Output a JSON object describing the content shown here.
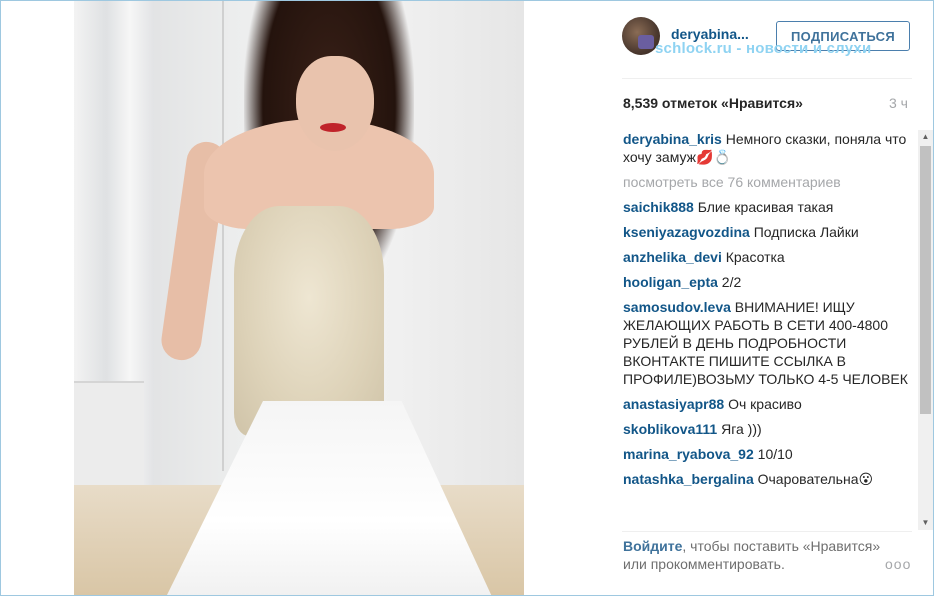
{
  "header": {
    "username": "deryabina...",
    "follow_label": "ПОДПИСАТЬСЯ"
  },
  "watermark": "schlock.ru - новости и слухи",
  "stats": {
    "likes": "8,539 отметок «Нравится»",
    "time_ago": "3 ч"
  },
  "caption": {
    "author": "deryabina_kris",
    "text": "Немного сказки, поняла что хочу замуж💋💍"
  },
  "view_all": "посмотреть все 76 комментариев",
  "comments": [
    {
      "author": "saichik888",
      "text": "Блие красивая такая"
    },
    {
      "author": "kseniyazagvozdina",
      "text": "Подписка Лайки"
    },
    {
      "author": "anzhelika_devi",
      "text": "Красотка"
    },
    {
      "author": "hooligan_epta",
      "text": "2/2"
    },
    {
      "author": "samosudov.leva",
      "text": "ВНИМАНИЕ! ИЩУ ЖЕЛАЮЩИХ РАБОТЬ В СЕТИ 400-4800 РУБЛЕЙ В ДЕНЬ ПОДРОБНОСТИ ВКОНТАКТЕ ПИШИТЕ ССЫЛКА В ПРОФИЛЕ)ВОЗЬМУ ТОЛЬКО 4-5 ЧЕЛОВЕК"
    },
    {
      "author": "anastasiyapr88",
      "text": "Оч красиво"
    },
    {
      "author": "skoblikova111",
      "text": "Яга )))"
    },
    {
      "author": "marina_ryabova_92",
      "text": "10/10"
    },
    {
      "author": "natashka_bergalina",
      "text": "Очаровательна😮"
    }
  ],
  "footer": {
    "login_link": "Войдите",
    "text": ", чтобы поставить «Нравится» или прокомментировать.",
    "more_label": "ооо"
  },
  "colors": {
    "link": "#125688",
    "accent": "#3f729b",
    "muted": "#a5a7aa",
    "watermark": "#8fd3f2"
  },
  "icons": {
    "avatar": "profile-avatar",
    "more": "more-options-icon"
  }
}
